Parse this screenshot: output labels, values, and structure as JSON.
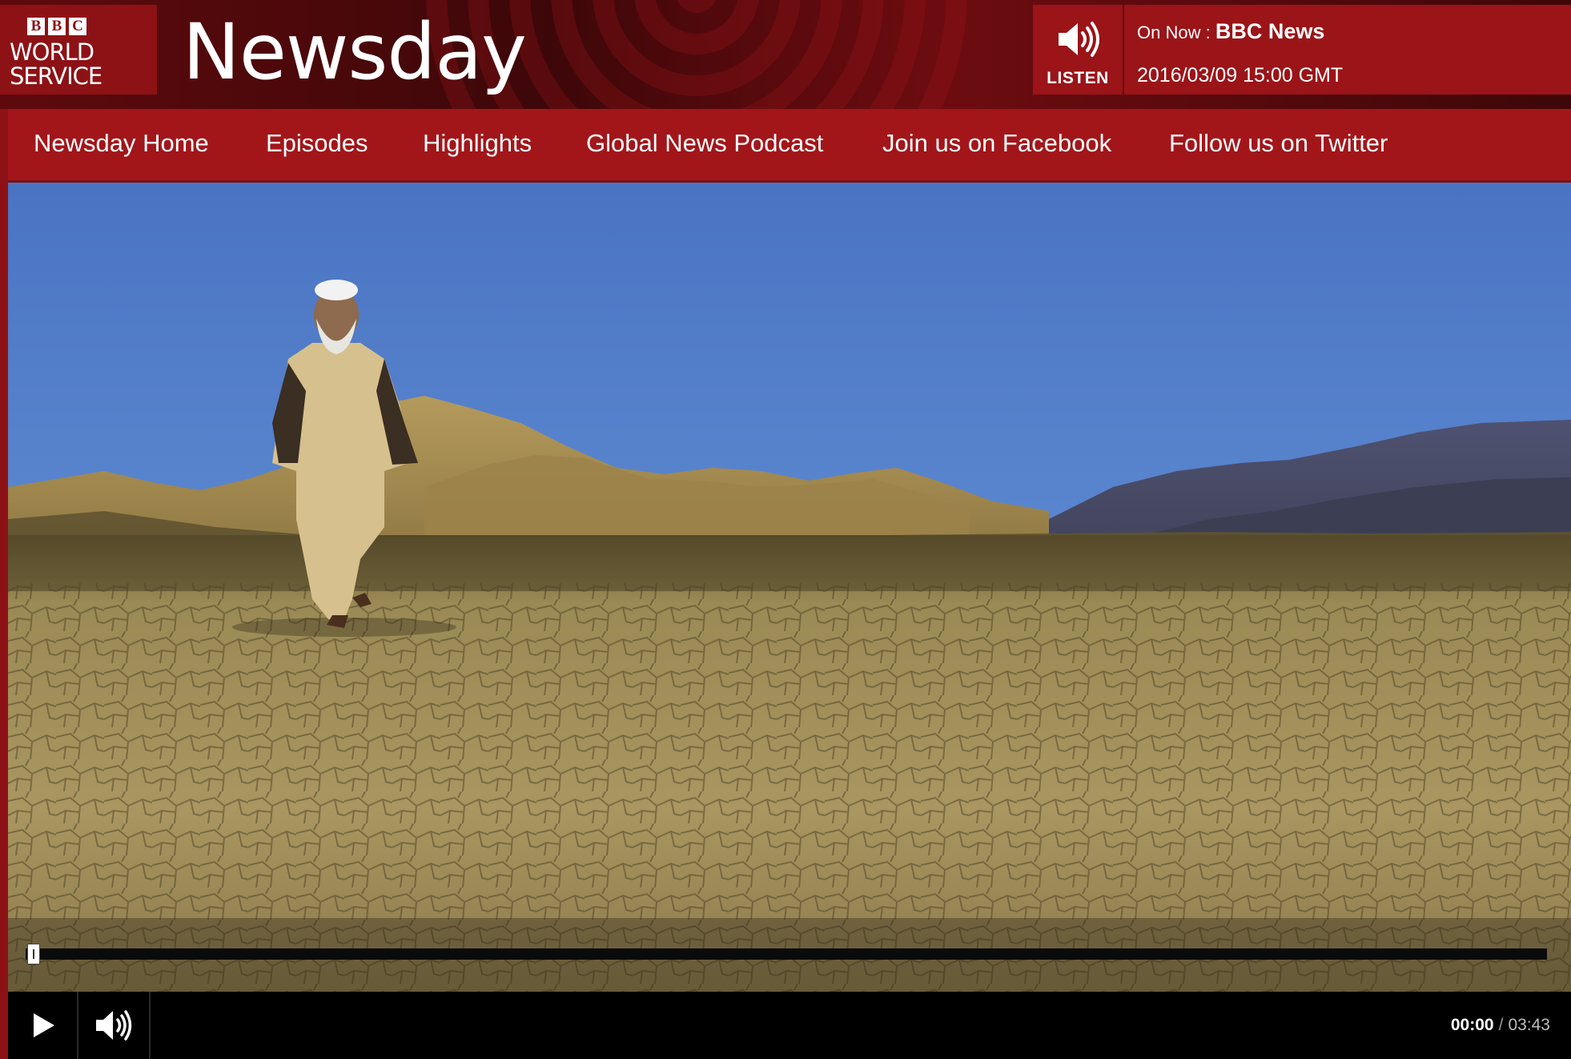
{
  "brand": {
    "logo_blocks": [
      "B",
      "B",
      "C"
    ],
    "logo_line1": "WORLD",
    "logo_line2": "SERVICE",
    "programme_title": "Newsday"
  },
  "live": {
    "listen_label": "LISTEN",
    "listen_icon": "speaker-icon",
    "on_now_prefix": "On Now :",
    "on_now_show": "BBC News",
    "broadcast_time": "2016/03/09 15:00 GMT"
  },
  "nav": {
    "items": [
      {
        "label": "Newsday Home"
      },
      {
        "label": "Episodes"
      },
      {
        "label": "Highlights"
      },
      {
        "label": "Global News Podcast"
      },
      {
        "label": "Join us on Facebook"
      },
      {
        "label": "Follow us on Twitter"
      }
    ]
  },
  "player": {
    "play_icon": "play-icon",
    "volume_icon": "volume-icon",
    "current_time": "00:00",
    "separator": "/",
    "duration": "03:43",
    "progress": 0
  },
  "colors": {
    "brand_red": "#a2161a",
    "dark_red": "#5e0a0d",
    "player_black": "#000000"
  }
}
